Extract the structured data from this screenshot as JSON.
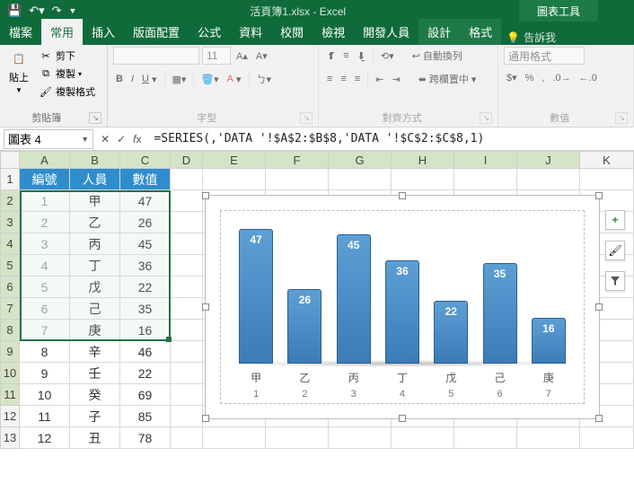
{
  "title": "活頁簿1.xlsx - Excel",
  "chart_tools": "圖表工具",
  "tabs": {
    "file": "檔案",
    "home": "常用",
    "insert": "插入",
    "layout": "版面配置",
    "formulas": "公式",
    "data": "資料",
    "review": "校閱",
    "view": "檢視",
    "dev": "開發人員",
    "design": "設計",
    "format": "格式",
    "tell": "告訴我"
  },
  "ribbon": {
    "clipboard": {
      "paste": "貼上",
      "cut": "剪下",
      "copy": "複製",
      "painter": "複製格式",
      "label": "剪貼簿"
    },
    "font": {
      "size": "11",
      "label": "字型"
    },
    "align": {
      "wrap": "自動換列",
      "merge": "跨欄置中",
      "label": "對齊方式"
    },
    "number": {
      "format": "通用格式",
      "label": "數值"
    }
  },
  "namebox": "圖表 4",
  "formula": "=SERIES(,'DATA '!$A$2:$B$8,'DATA '!$C$2:$C$8,1)",
  "cols": [
    "A",
    "B",
    "C",
    "D",
    "E",
    "F",
    "G",
    "H",
    "I",
    "J",
    "K"
  ],
  "headers": {
    "id": "編號",
    "name": "人員",
    "val": "數值"
  },
  "rows": [
    {
      "n": "1",
      "p": "甲",
      "v": "47"
    },
    {
      "n": "2",
      "p": "乙",
      "v": "26"
    },
    {
      "n": "3",
      "p": "丙",
      "v": "45"
    },
    {
      "n": "4",
      "p": "丁",
      "v": "36"
    },
    {
      "n": "5",
      "p": "戊",
      "v": "22"
    },
    {
      "n": "6",
      "p": "己",
      "v": "35"
    },
    {
      "n": "7",
      "p": "庚",
      "v": "16"
    },
    {
      "n": "8",
      "p": "辛",
      "v": "46"
    },
    {
      "n": "9",
      "p": "壬",
      "v": "22"
    },
    {
      "n": "10",
      "p": "癸",
      "v": "69"
    },
    {
      "n": "11",
      "p": "子",
      "v": "85"
    },
    {
      "n": "12",
      "p": "丑",
      "v": "78"
    }
  ],
  "chart_data": {
    "type": "bar",
    "categories": [
      "甲",
      "乙",
      "丙",
      "丁",
      "戊",
      "己",
      "庚"
    ],
    "index": [
      "1",
      "2",
      "3",
      "4",
      "5",
      "6",
      "7"
    ],
    "values": [
      47,
      26,
      45,
      36,
      22,
      35,
      16
    ],
    "title": "",
    "xlabel": "",
    "ylabel": "",
    "ylim": [
      0,
      50
    ]
  }
}
